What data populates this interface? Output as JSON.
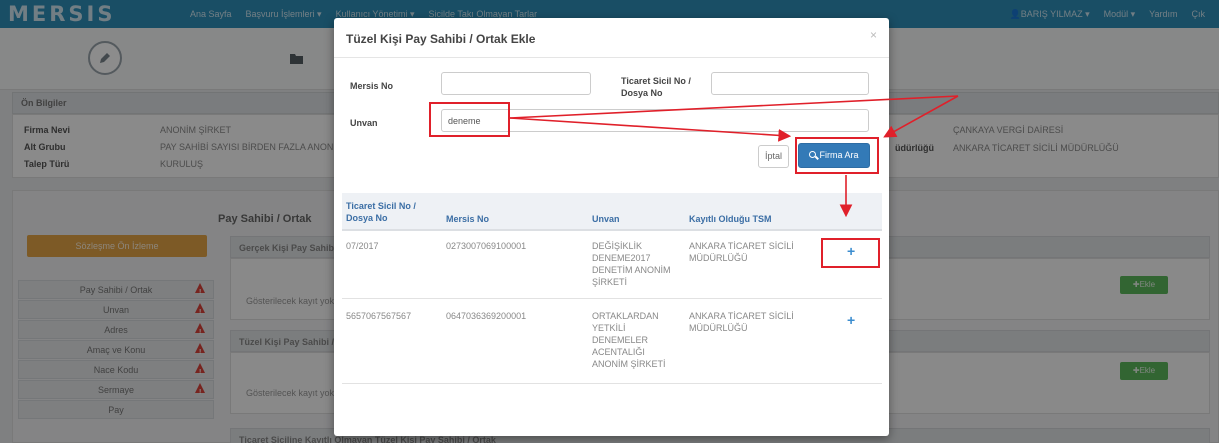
{
  "topnav": {
    "logo": "MERSIS",
    "items": [
      "Ana Sayfa",
      "Başvuru İşlemleri ▾",
      "Kullanıcı Yönetimi ▾",
      "Sicilde Takı Olmayan Tarlar"
    ],
    "right_items": [
      "👤BARIŞ YILMAZ ▾",
      "Modül ▾",
      "Yardım",
      "Çık"
    ]
  },
  "on_bilgiler": {
    "title": "Ön Bilgiler",
    "fields": [
      {
        "label": "Firma Nevi",
        "value": "ANONİM ŞİRKET"
      },
      {
        "label": "Alt Grubu",
        "value": "PAY SAHİBİ SAYISI BİRDEN FAZLA ANONİM ŞİRKET"
      },
      {
        "label": "Talep Türü",
        "value": "KURULUŞ"
      }
    ],
    "right_values": [
      "ÇANKAYA VERGİ DAİRESİ",
      "ANKARA TİCARET SİCİLİ MÜDÜRLÜĞÜ"
    ],
    "right_label_fragment": "üdürlüğü"
  },
  "sidebar": {
    "sozlesme_button": "Sözleşme Ön İzleme",
    "items": [
      "Pay Sahibi / Ortak",
      "Unvan",
      "Adres",
      "Amaç ve Konu",
      "Nace Kodu",
      "Sermaye",
      "Pay"
    ]
  },
  "content": {
    "title": "Pay Sahibi / Ortak",
    "section1": "Gerçek Kişi Pay Sahibi / Ortak",
    "section2": "Tüzel Kişi Pay Sahibi / Ortak",
    "section3": "Ticaret Siciline Kayıtlı Olmayan Tüzel Kişi Pay Sahibi / Ortak",
    "empty_text": "Gösterilecek kayıt yok",
    "ekle_label": "Ekle"
  },
  "modal": {
    "title": "Tüzel Kişi Pay Sahibi / Ortak Ekle",
    "close": "×",
    "mersis_label": "Mersis No",
    "mersis_value": "",
    "ticaret_label": "Ticaret Sicil No / Dosya No",
    "ticaret_value": "",
    "unvan_label": "Unvan",
    "unvan_value": "deneme",
    "iptal_label": "İptal",
    "ara_label": "Firma Ara",
    "table": {
      "headers": [
        "Ticaret Sicil No / Dosya No",
        "Mersis No",
        "Unvan",
        "Kayıtlı Olduğu TSM"
      ],
      "rows": [
        {
          "sicil": "07/2017",
          "mersis": "0273007069100001",
          "unvan": "DEĞİŞİKLİK DENEME2017 DENETİM ANONİM ŞİRKETİ",
          "tsm": "ANKARA TİCARET SİCİLİ MÜDÜRLÜĞÜ",
          "action": "+"
        },
        {
          "sicil": "5657067567567",
          "mersis": "0647036369200001",
          "unvan": "ORTAKLARDAN YETKİLİ DENEMELER ACENTALIĞI ANONİM ŞİRKETİ",
          "tsm": "ANKARA TİCARET SİCİLİ MÜDÜRLÜĞÜ",
          "action": "+"
        }
      ]
    }
  },
  "colors": {
    "nav": "#2f8fb8",
    "primary_button": "#337ab7",
    "annotation": "#e0202a",
    "warning": "#d9423a",
    "success": "#5cb85c",
    "orange": "#e3a445"
  },
  "icons": [
    "pencil-icon",
    "folder-icon",
    "search-icon",
    "warning-icon",
    "plus-icon",
    "close-icon",
    "user-icon"
  ]
}
